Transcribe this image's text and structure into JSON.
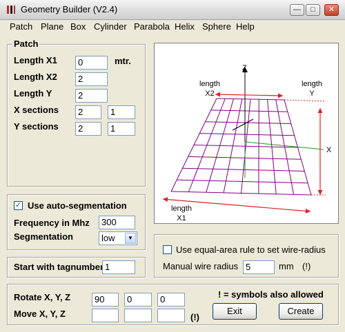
{
  "window": {
    "title": "Geometry Builder (V2.4)"
  },
  "menu": [
    "Patch",
    "Plane",
    "Box",
    "Cylinder",
    "Parabola",
    "Helix",
    "Sphere",
    "Help"
  ],
  "patch": {
    "title": "Patch",
    "length_x1_label": "Length X1",
    "length_x1": "0",
    "unit": "mtr.",
    "length_x2_label": "Length X2",
    "length_x2": "2",
    "length_y_label": "Length Y",
    "length_y": "2",
    "x_sections_label": "X sections",
    "x_sections_1": "2",
    "x_sections_2": "1",
    "y_sections_label": "Y sections",
    "y_sections_1": "2",
    "y_sections_2": "1"
  },
  "segmentation": {
    "auto_label": "Use auto-segmentation",
    "auto_checked": true,
    "frequency_label": "Frequency in Mhz",
    "frequency": "300",
    "segmentation_label": "Segmentation",
    "segmentation_value": "low"
  },
  "tag": {
    "label": "Start with tagnumber",
    "value": "1"
  },
  "wire": {
    "equal_area_label": "Use equal-area rule to set wire-radius",
    "equal_area_checked": false,
    "manual_label": "Manual wire radius",
    "manual_value": "5",
    "unit": "mm",
    "note": "(!)"
  },
  "transform": {
    "rotate_label": "Rotate X, Y, Z",
    "rotate_x": "90",
    "rotate_y": "0",
    "rotate_z": "0",
    "move_label": "Move X, Y, Z",
    "move_x": "",
    "move_y": "",
    "move_z": "",
    "move_note": "(!)",
    "symbols_note": "! =  symbols also allowed",
    "exit_label": "Exit",
    "create_label": "Create"
  },
  "diagram": {
    "z_label": "Z",
    "x_label": "X",
    "length_x2_label_1": "length",
    "length_x2_label_2": "X2",
    "length_y_label_1": "length",
    "length_y_label_2": "Y",
    "length_x1_label_1": "length",
    "length_x1_label_2": "X1",
    "colors": {
      "grid": "#800080",
      "arrows": "#e02020",
      "axes": "#1a9a1a",
      "zaxis": "#000000"
    }
  }
}
